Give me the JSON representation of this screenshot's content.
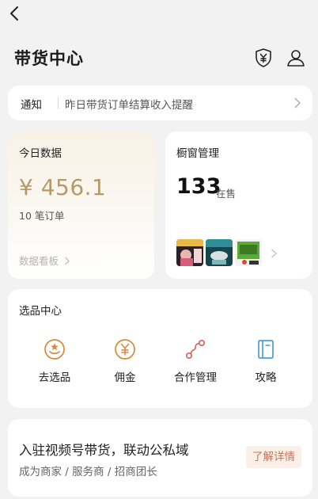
{
  "header": {
    "title": "带货中心"
  },
  "notice": {
    "tag": "通知",
    "message": "昨日带货订单结算收入提醒"
  },
  "today": {
    "label": "今日数据",
    "amount": "¥ 456.1",
    "orders": "10 笔订单",
    "more": "数据看板"
  },
  "showcase": {
    "label": "橱窗管理",
    "count": "133",
    "unit": "在售"
  },
  "selection": {
    "label": "选品中心",
    "items": [
      {
        "label": "去选品",
        "icon": "product-select-icon"
      },
      {
        "label": "佣金",
        "icon": "yuan-coin-icon"
      },
      {
        "label": "合作管理",
        "icon": "cooperation-icon"
      },
      {
        "label": "攻略",
        "icon": "guide-book-icon"
      }
    ]
  },
  "promo": {
    "headline": "入驻视频号带货，联动公私域",
    "subtitle": "成为商家 / 服务商 / 招商团长",
    "cta": "了解详情"
  },
  "colors": {
    "gold": "#b79968",
    "accent_orange": "#d78a3d",
    "cta_bg": "#fbefe7",
    "cta_text": "#c0775a",
    "guide_blue": "#4b9fd5"
  }
}
